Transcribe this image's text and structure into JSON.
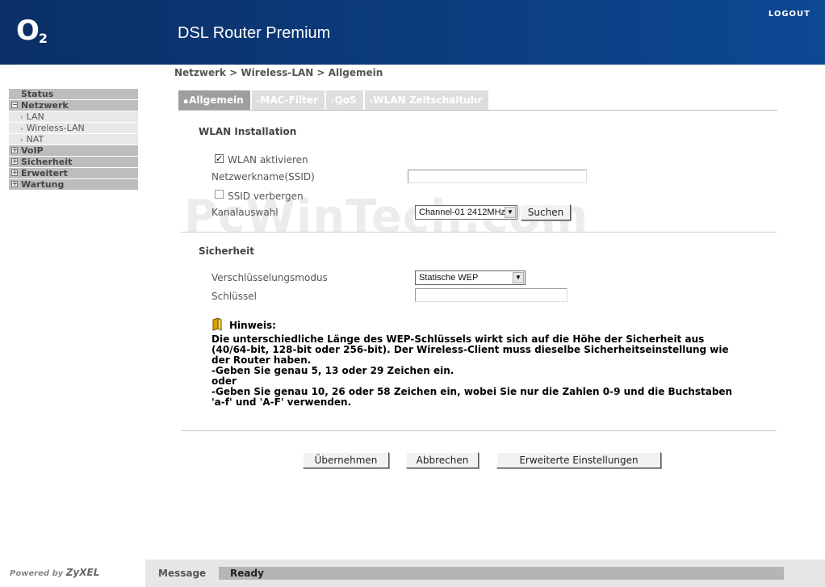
{
  "header": {
    "logo": "O",
    "logo_sub": "2",
    "product": "DSL Router Premium",
    "logout": "LOGOUT"
  },
  "breadcrumb": "Netzwerk > Wireless-LAN > Allgemein",
  "sidebar": {
    "status": "Status",
    "netzwerk": "Netzwerk",
    "lan": "LAN",
    "wlan": "Wireless-LAN",
    "nat": "NAT",
    "voip": "VoIP",
    "sicherheit": "Sicherheit",
    "erweitert": "Erweitert",
    "wartung": "Wartung"
  },
  "tabs": {
    "allgemein": "Allgemein",
    "mac": "MAC-Filter",
    "qos": "QoS",
    "zeit": "WLAN Zeitschaltuhr"
  },
  "wlan": {
    "section": "WLAN Installation",
    "activate_label": "WLAN aktivieren",
    "activate_checked": true,
    "ssid_label": "Netzwerkname(SSID)",
    "hide_label": "SSID verbergen",
    "hide_checked": false,
    "channel_label": "Kanalauswahl",
    "channel_value": "Channel-01 2412MHz",
    "scan_button": "Suchen"
  },
  "security": {
    "section": "Sicherheit",
    "mode_label": "Verschlüsselungsmodus",
    "mode_value": "Statische WEP",
    "key_label": "Schlüssel"
  },
  "hint": {
    "title": "Hinweis:",
    "line1": "Die unterschiedliche Länge des WEP-Schlüssels wirkt sich auf die Höhe der Sicherheit aus (40/64-bit, 128-bit oder 256-bit). Der Wireless-Client muss dieselbe Sicherheitseinstellung wie der Router haben.",
    "line2": "-Geben Sie genau 5, 13 oder 29 Zeichen ein.",
    "line3": "oder",
    "line4": "-Geben Sie genau 10, 26 oder 58 Zeichen ein, wobei Sie nur die Zahlen 0-9 und die Buchstaben 'a-f' und 'A-F' verwenden."
  },
  "buttons": {
    "apply": "Übernehmen",
    "cancel": "Abbrechen",
    "advanced": "Erweiterte Einstellungen"
  },
  "footer": {
    "powered": "Powered by",
    "brand": "ZyXEL",
    "message_label": "Message",
    "message_value": "Ready"
  },
  "watermark": "PcWinTech.com"
}
